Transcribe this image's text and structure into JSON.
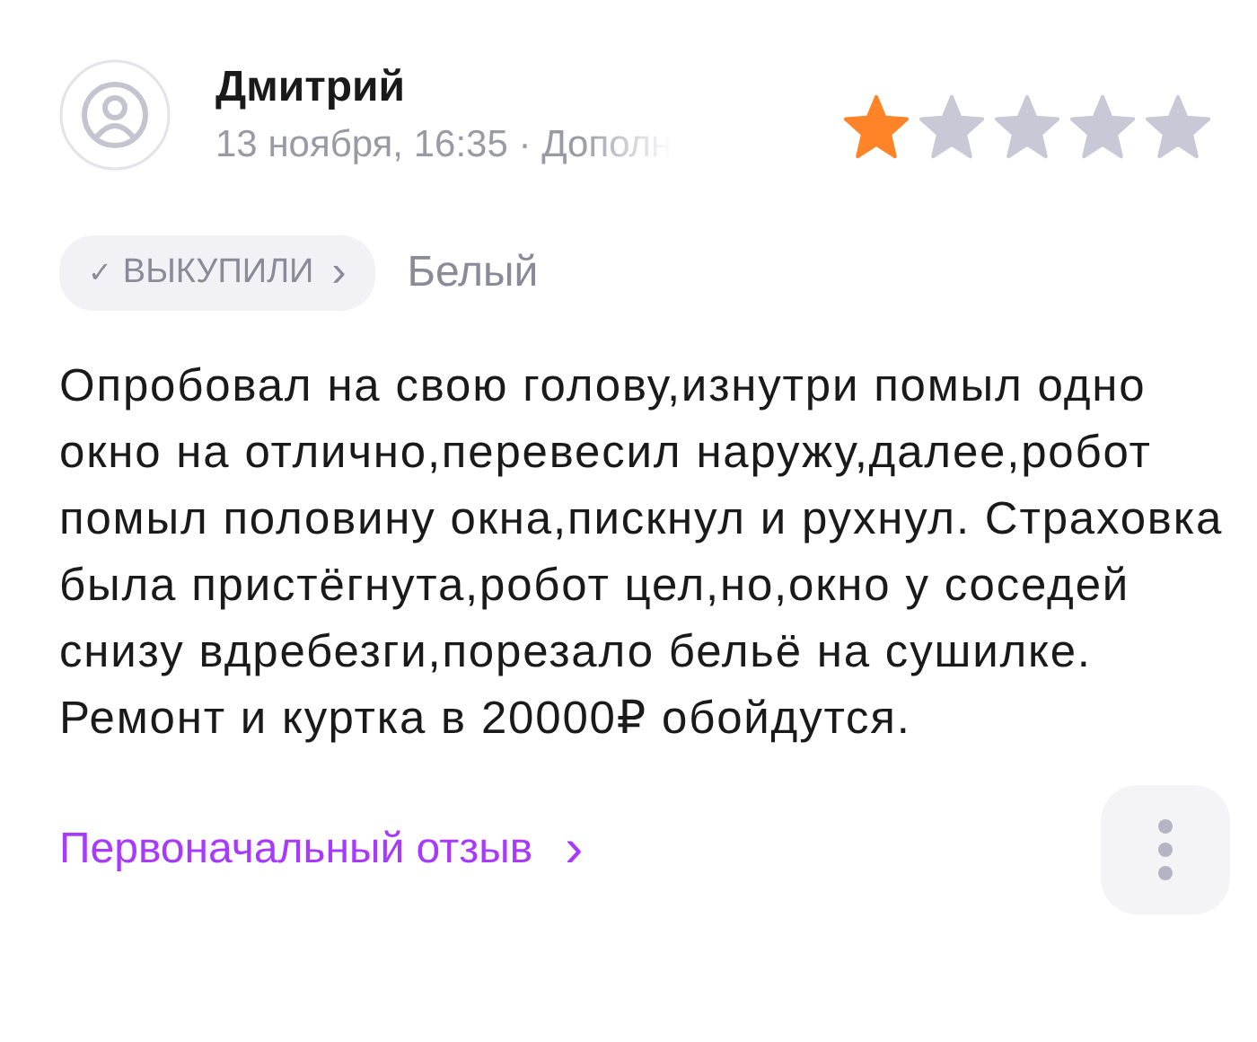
{
  "review": {
    "author": "Дмитрий",
    "meta": "13 ноября, 16:35 · Дополн",
    "stars": 1,
    "purchase_badge": {
      "check": "✓",
      "label": "ВЫКУПИЛИ",
      "arrow": "›"
    },
    "variant": "Белый",
    "text": "Опробовал на свою голову,изнутри помыл одно окно на отлично,перевесил наружу,далее,робот помыл половину окна,пискнул и рухнул. Страховка была пристёгнута,робот цел,но,окно у соседей снизу вдребезги,порезало бельё на сушилке. Ремонт и куртка в 20000₽ обойдутся.",
    "original_link": {
      "label": "Первоначальный отзыв",
      "arrow": "›"
    }
  }
}
